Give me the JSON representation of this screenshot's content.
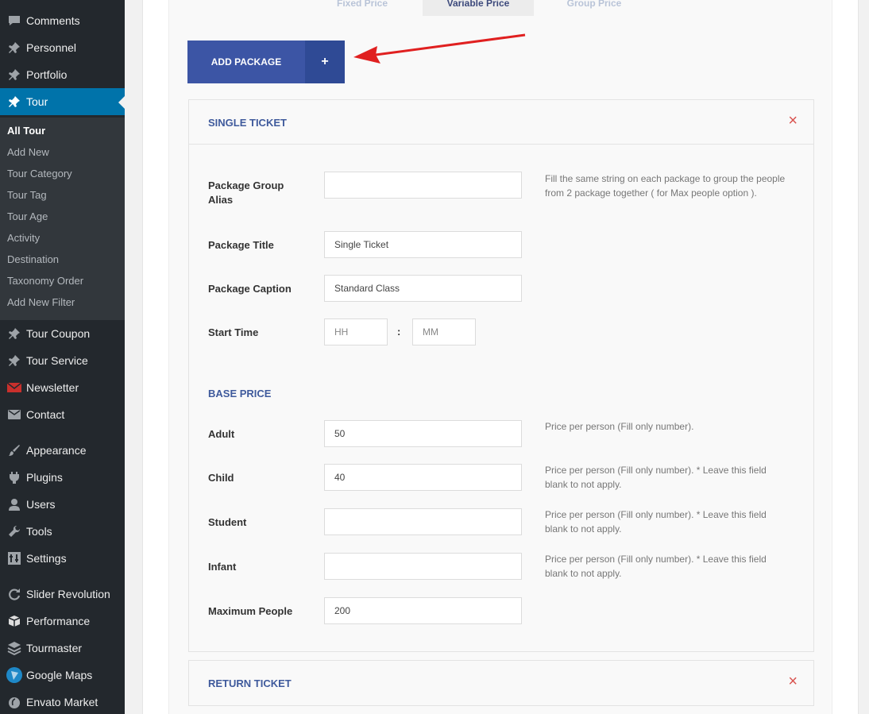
{
  "sidebar": {
    "items": [
      {
        "label": "Comments",
        "icon": "comment-icon"
      },
      {
        "label": "Personnel",
        "icon": "pin-icon"
      },
      {
        "label": "Portfolio",
        "icon": "pin-icon"
      },
      {
        "label": "Tour",
        "icon": "pin-icon"
      },
      {
        "label": "Tour Coupon",
        "icon": "pin-icon"
      },
      {
        "label": "Tour Service",
        "icon": "pin-icon"
      },
      {
        "label": "Newsletter",
        "icon": "envelope-icon"
      },
      {
        "label": "Contact",
        "icon": "mail-icon"
      },
      {
        "label": "Appearance",
        "icon": "brush-icon"
      },
      {
        "label": "Plugins",
        "icon": "plugin-icon"
      },
      {
        "label": "Users",
        "icon": "user-icon"
      },
      {
        "label": "Tools",
        "icon": "wrench-icon"
      },
      {
        "label": "Settings",
        "icon": "settings-icon"
      },
      {
        "label": "Slider Revolution",
        "icon": "refresh-icon"
      },
      {
        "label": "Performance",
        "icon": "cube-icon"
      },
      {
        "label": "Tourmaster",
        "icon": "layers-icon"
      },
      {
        "label": "Google Maps",
        "icon": "map-icon"
      },
      {
        "label": "Envato Market",
        "icon": "leaf-icon"
      }
    ],
    "submenu": [
      "All Tour",
      "Add New",
      "Tour Category",
      "Tour Tag",
      "Tour Age",
      "Activity",
      "Destination",
      "Taxonomy Order",
      "Add New Filter"
    ]
  },
  "tabs": [
    "Fixed Price",
    "Variable Price",
    "Group Price"
  ],
  "add_package": {
    "label": "ADD PACKAGE",
    "plus": "+"
  },
  "single_ticket": {
    "title": "SINGLE TICKET",
    "close": "×",
    "fields": {
      "group_alias": {
        "label": "Package Group Alias",
        "value": "",
        "help": "Fill the same string on each package to group the people from 2 package together ( for Max people option )."
      },
      "title": {
        "label": "Package Title",
        "value": "Single Ticket"
      },
      "caption": {
        "label": "Package Caption",
        "value": "Standard Class"
      },
      "start_time": {
        "label": "Start Time",
        "hh": "HH",
        "mm": "MM",
        "sep": ":"
      }
    },
    "base_price": {
      "title": "BASE PRICE",
      "adult": {
        "label": "Adult",
        "value": "50",
        "help": "Price per person (Fill only number)."
      },
      "child": {
        "label": "Child",
        "value": "40",
        "help": "Price per person (Fill only number). * Leave this field blank to not apply."
      },
      "student": {
        "label": "Student",
        "value": "",
        "help": "Price per person (Fill only number). * Leave this field blank to not apply."
      },
      "infant": {
        "label": "Infant",
        "value": "",
        "help": "Price per person (Fill only number). * Leave this field blank to not apply."
      },
      "max_people": {
        "label": "Maximum People",
        "value": "200"
      }
    }
  },
  "return_ticket": {
    "title": "RETURN TICKET",
    "close": "×"
  },
  "colors": {
    "sidebar_bg": "#23282d",
    "active": "#0073aa",
    "button": "#3c55a5",
    "accent_text": "#3f5a9c",
    "close": "#d9534f",
    "arrow": "#e02020"
  }
}
